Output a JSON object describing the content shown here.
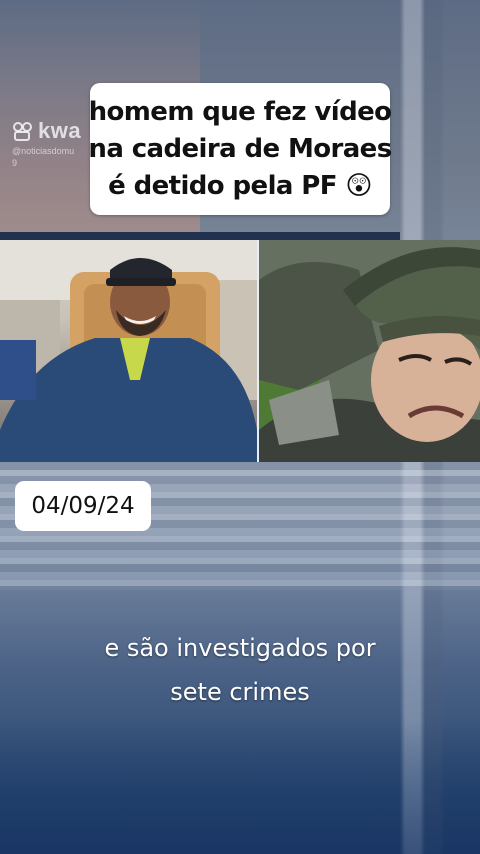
{
  "watermark": {
    "app_name": "kwa",
    "handle": "@noticiasdomu",
    "handle_sub": "9",
    "icon": "kwai-logo-icon"
  },
  "headline": {
    "lines": [
      "homem que fez vídeo",
      "na cadeira de Moraes",
      "é detido pela PF 😲"
    ]
  },
  "date_badge": {
    "text": "04/09/24"
  },
  "caption": {
    "lines": [
      "e são investigados por",
      "sete crimes"
    ]
  },
  "video": {
    "left_panel": "man-in-blue-jacket-on-chair",
    "right_panel": "man-in-hat-lying-on-ground"
  },
  "colors": {
    "headline_bg": "#ffffff",
    "headline_text": "#111111",
    "caption_text": "#ffffff",
    "frame_divider": "#e8eef7"
  }
}
